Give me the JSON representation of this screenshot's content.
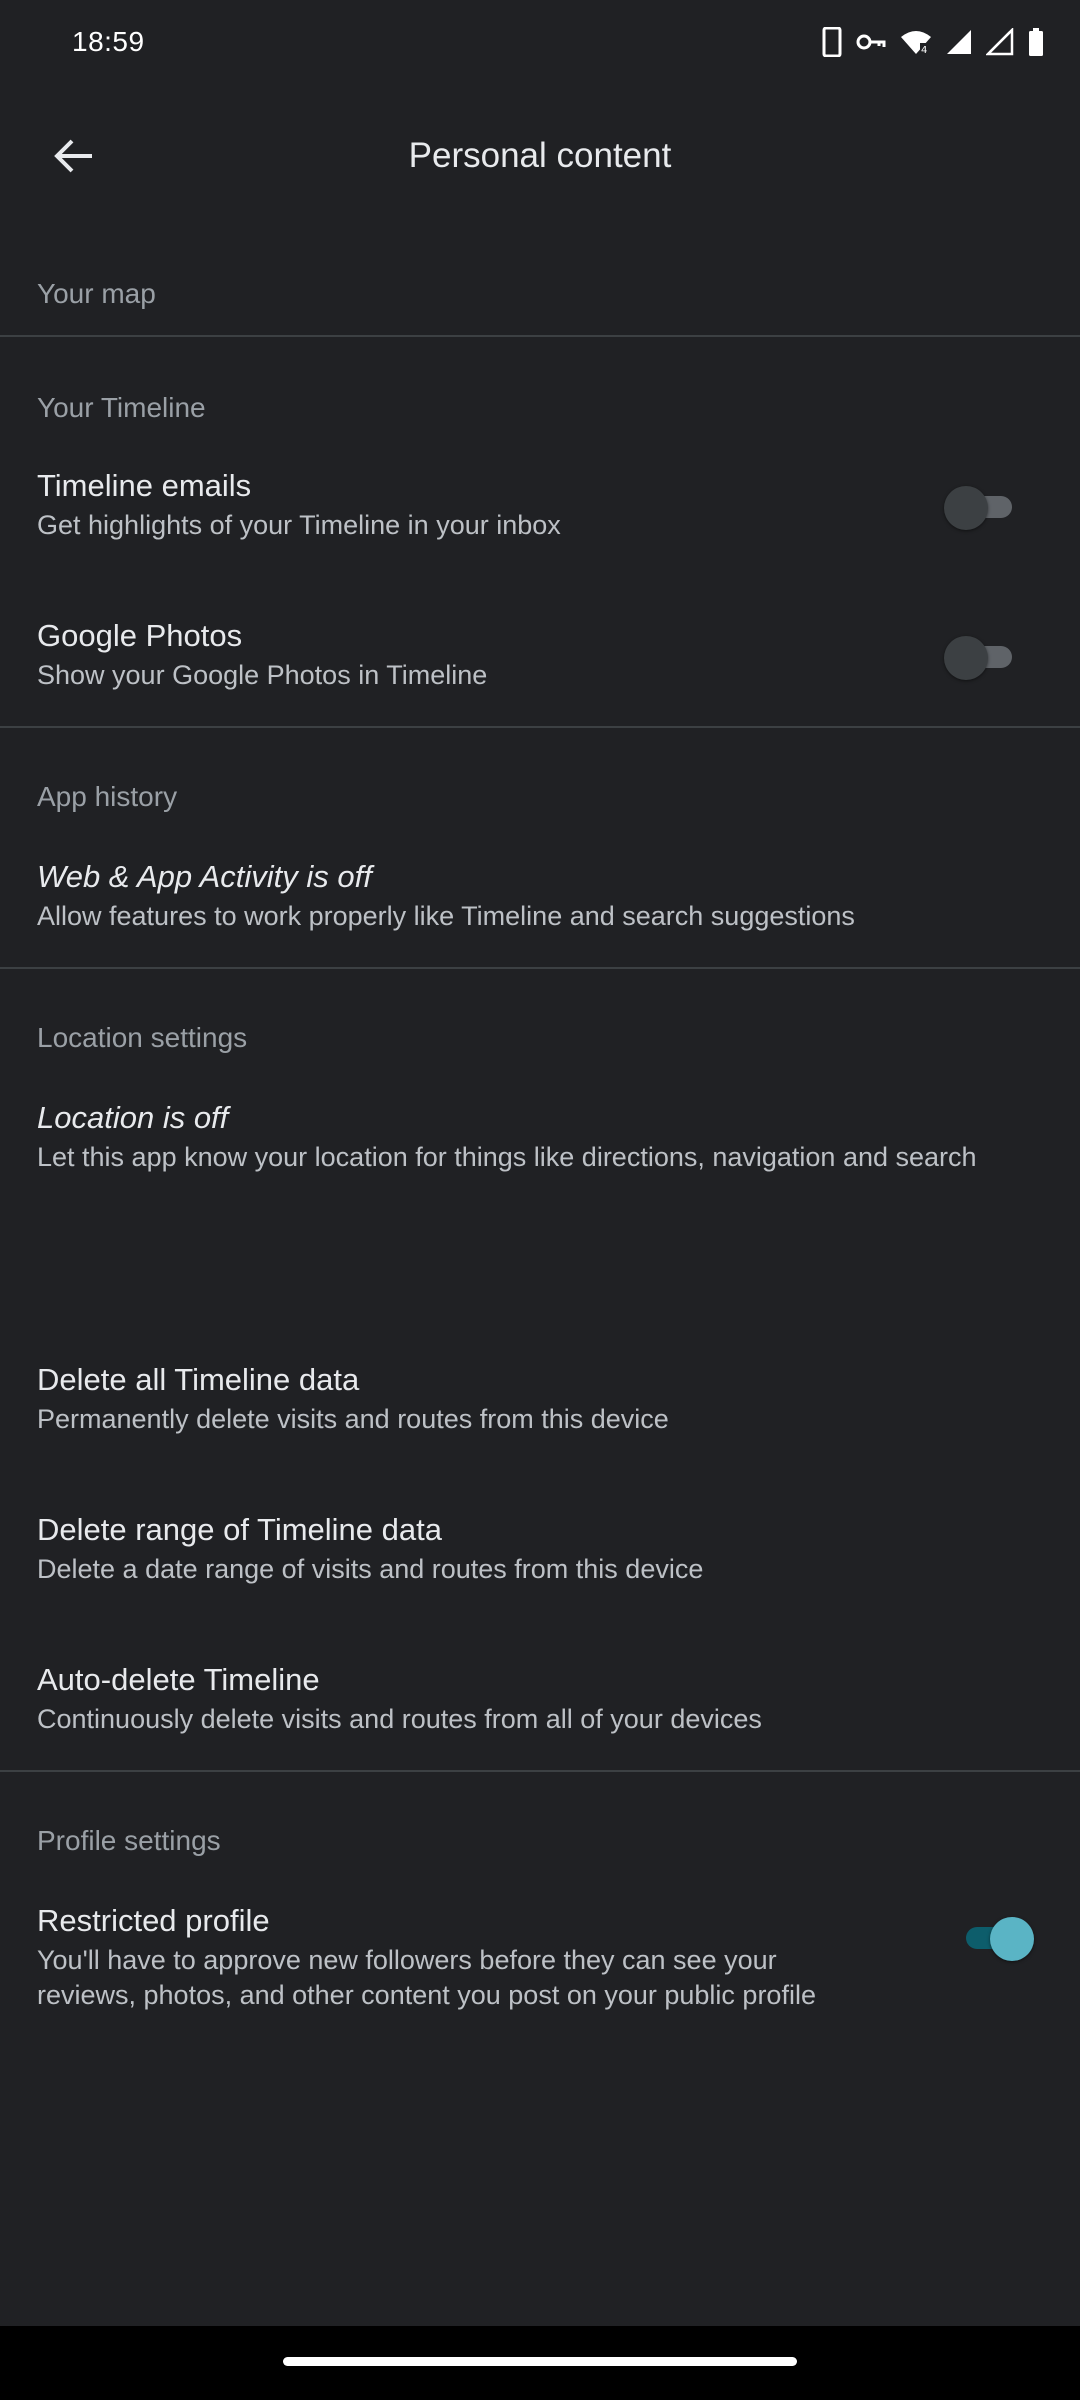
{
  "status_bar": {
    "time": "18:59",
    "icons": [
      "phone-icon",
      "vpn-key-icon",
      "wifi-icon",
      "cell-signal-icon",
      "no-data-icon",
      "battery-icon"
    ]
  },
  "app_bar": {
    "title": "Personal content",
    "back_icon": "arrow-back-icon"
  },
  "sections": {
    "your_map": {
      "header": "Your map"
    },
    "your_timeline": {
      "header": "Your Timeline",
      "timeline_emails": {
        "title": "Timeline emails",
        "subtitle": "Get highlights of your Timeline in your inbox",
        "enabled": false
      },
      "google_photos": {
        "title": "Google Photos",
        "subtitle": "Show your Google Photos in Timeline",
        "enabled": false
      }
    },
    "app_history": {
      "header": "App history",
      "web_app_activity": {
        "title": "Web & App Activity is off",
        "subtitle": "Allow features to work properly like Timeline and search suggestions"
      }
    },
    "location_settings": {
      "header": "Location settings",
      "location": {
        "title": "Location is off",
        "subtitle": "Let this app know your location for things like directions, navigation and search"
      },
      "delete_all": {
        "title": "Delete all Timeline data",
        "subtitle": "Permanently delete visits and routes from this device"
      },
      "delete_range": {
        "title": "Delete range of Timeline data",
        "subtitle": "Delete a date range of visits and routes from this device"
      },
      "auto_delete": {
        "title": "Auto-delete Timeline",
        "subtitle": "Continuously delete visits and routes from all of your devices"
      }
    },
    "profile_settings": {
      "header": "Profile settings",
      "restricted_profile": {
        "title": "Restricted profile",
        "subtitle_line1": "You'll have to approve new followers before they can see your",
        "subtitle_line2": "reviews, photos, and other content you post on your public profile",
        "enabled": true
      }
    }
  },
  "colors": {
    "background": "#202124",
    "text_primary": "#e8eaed",
    "text_secondary": "#bdc1c6",
    "section_header": "#9aa0a6",
    "divider": "#3c4043",
    "switch_on_thumb": "#5ab4c5",
    "switch_on_track": "#0d5d6b"
  }
}
